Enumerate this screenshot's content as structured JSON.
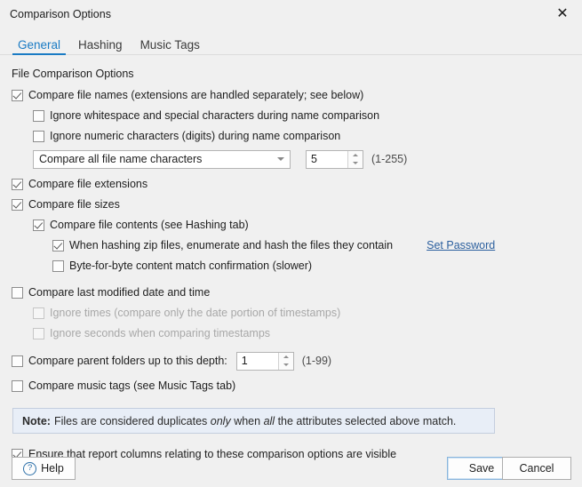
{
  "window": {
    "title": "Comparison Options",
    "close_icon": "close-icon"
  },
  "tabs": [
    {
      "label": "General",
      "active": true
    },
    {
      "label": "Hashing",
      "active": false
    },
    {
      "label": "Music Tags",
      "active": false
    }
  ],
  "main": {
    "section_title": "File Comparison Options",
    "options": [
      {
        "id": "compare-file-names",
        "label": "Compare file names (extensions are handled separately; see below)",
        "checked": true,
        "indent": 0,
        "disabled": false
      },
      {
        "id": "ignore-whitespace",
        "label": "Ignore whitespace and special characters during name comparison",
        "checked": false,
        "indent": 1,
        "disabled": false
      },
      {
        "id": "ignore-numeric",
        "label": "Ignore numeric characters (digits) during name comparison",
        "checked": false,
        "indent": 1,
        "disabled": false
      },
      {
        "id": "compare-file-extensions",
        "label": "Compare file extensions",
        "checked": true,
        "indent": 0,
        "disabled": false
      },
      {
        "id": "compare-file-sizes",
        "label": "Compare file sizes",
        "checked": true,
        "indent": 0,
        "disabled": false
      },
      {
        "id": "compare-file-contents",
        "label": "Compare file contents (see Hashing tab)",
        "checked": true,
        "indent": 1,
        "disabled": false
      },
      {
        "id": "hash-zip-files",
        "label": "When hashing zip files, enumerate and hash the files they contain",
        "checked": true,
        "indent": 2,
        "disabled": false
      },
      {
        "id": "byte-for-byte",
        "label": "Byte-for-byte content match confirmation (slower)",
        "checked": false,
        "indent": 2,
        "disabled": false
      },
      {
        "id": "compare-last-modified",
        "label": "Compare last modified date and time",
        "checked": false,
        "indent": 0,
        "disabled": false
      },
      {
        "id": "ignore-times",
        "label": "Ignore times (compare only the date portion of timestamps)",
        "checked": false,
        "indent": 1,
        "disabled": true
      },
      {
        "id": "ignore-seconds",
        "label": "Ignore seconds when comparing timestamps",
        "checked": false,
        "indent": 1,
        "disabled": true
      }
    ],
    "name_chars": {
      "select_value": "Compare all file name characters",
      "spinner_value": "5",
      "range_hint": "(1-255)"
    },
    "set_password_link": "Set Password",
    "parent_folders": {
      "label": "Compare parent folders up to this depth:",
      "checked": false,
      "spinner_value": "1",
      "range_hint": "(1-99)"
    },
    "music_tags": {
      "label": "Compare music tags (see Music Tags tab)",
      "checked": false
    },
    "note": {
      "prefix": "Note:",
      "part1": "Files are considered duplicates",
      "em1": "only",
      "part2": "when",
      "em2": "all",
      "part3": "the attributes selected above match."
    },
    "ensure_columns": {
      "label": "Ensure that report columns relating to these comparison options are visible",
      "checked": true
    }
  },
  "footer": {
    "help_label": "Help",
    "help_icon": "question-mark-icon",
    "save_label": "Save",
    "cancel_label": "Cancel"
  },
  "colors": {
    "accent": "#1a7bc4",
    "link": "#2b5f9e",
    "note_bg": "#e8eef7",
    "window_bg": "#f0f0f0"
  }
}
